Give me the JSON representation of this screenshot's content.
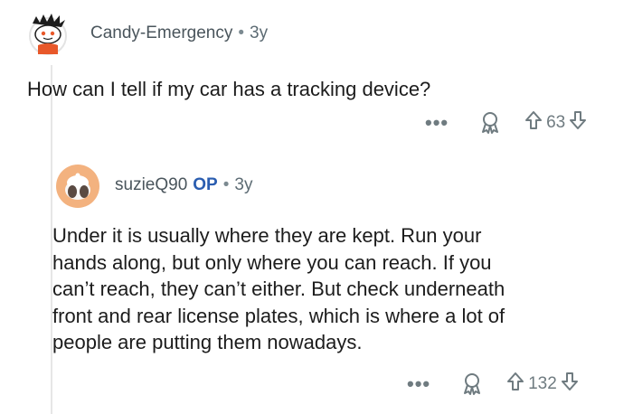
{
  "top_comment": {
    "username": "Candy-Emergency",
    "separator": "•",
    "age": "3y",
    "body": "How can I tell if my car has a tracking device?",
    "more_label": "•••",
    "score": "63"
  },
  "reply": {
    "username": "suzieQ90",
    "op_badge": "OP",
    "separator": "•",
    "age": "3y",
    "body_lines": [
      "Under it is usually where they are kept. Run your",
      "hands along, but only where you can reach. If you",
      "can’t reach, they can’t either. But check underneath",
      "front and rear license plates, which is where a lot of",
      "people are putting them nowadays."
    ],
    "more_label": "•••",
    "score": "132"
  },
  "colors": {
    "meta_gray": "#5c6b73",
    "op_blue": "#2a5db0",
    "thread_line": "#e6e6e6"
  }
}
